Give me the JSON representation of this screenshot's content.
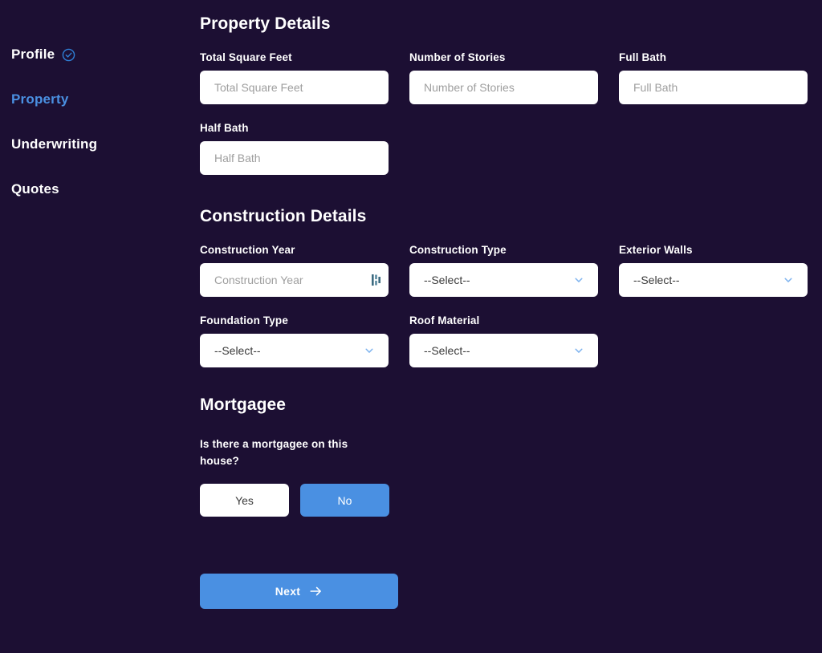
{
  "colors": {
    "background": "#1c0f33",
    "accent": "#4a90e2",
    "field_background": "#ffffff",
    "placeholder": "#9e9e9e",
    "text": "#ffffff"
  },
  "sidebar": {
    "items": [
      {
        "label": "Profile",
        "state": "complete",
        "icon": "check-circle-icon"
      },
      {
        "label": "Property",
        "state": "active",
        "icon": ""
      },
      {
        "label": "Underwriting",
        "state": "default",
        "icon": ""
      },
      {
        "label": "Quotes",
        "state": "default",
        "icon": ""
      }
    ]
  },
  "property_details": {
    "title": "Property Details",
    "fields": [
      {
        "label": "Total Square Feet",
        "placeholder": "Total Square Feet",
        "value": "",
        "type": "text"
      },
      {
        "label": "Number of Stories",
        "placeholder": "Number of Stories",
        "value": "",
        "type": "text"
      },
      {
        "label": "Full Bath",
        "placeholder": "Full Bath",
        "value": "",
        "type": "text"
      },
      {
        "label": "Half Bath",
        "placeholder": "Half Bath",
        "value": "",
        "type": "text"
      }
    ]
  },
  "construction_details": {
    "title": "Construction Details",
    "fields": [
      {
        "label": "Construction Year",
        "placeholder": "Construction Year",
        "value": "",
        "type": "text",
        "icon": "stepper-icon"
      },
      {
        "label": "Construction Type",
        "value": "--Select--",
        "type": "select",
        "icon": "chevron-down-icon"
      },
      {
        "label": "Exterior Walls",
        "value": "--Select--",
        "type": "select",
        "icon": "chevron-down-icon"
      },
      {
        "label": "Foundation Type",
        "value": "--Select--",
        "type": "select",
        "icon": "chevron-down-icon"
      },
      {
        "label": "Roof Material",
        "value": "--Select--",
        "type": "select",
        "icon": "chevron-down-icon"
      }
    ]
  },
  "mortgagee": {
    "title": "Mortgagee",
    "question": "Is there a mortgagee on this house?",
    "yes_label": "Yes",
    "no_label": "No",
    "selected": "No"
  },
  "footer": {
    "next_label": "Next",
    "next_icon": "arrow-right-icon"
  }
}
